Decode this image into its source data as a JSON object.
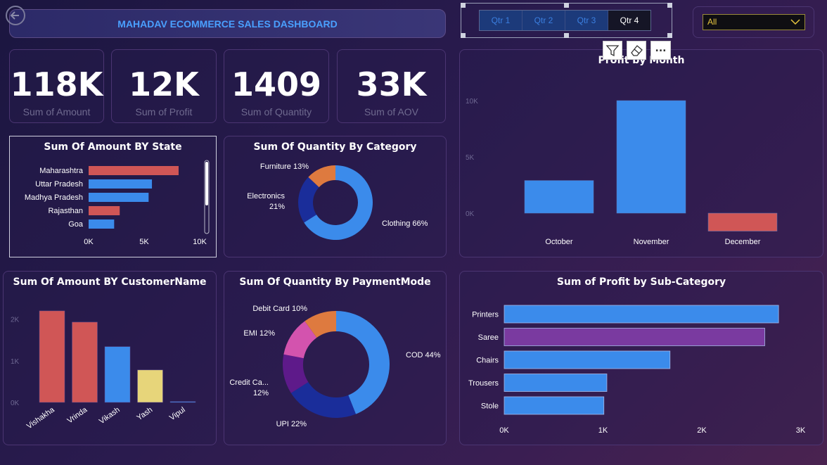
{
  "header": {
    "title": "MAHADAV ECOMMERCE SALES DASHBOARD"
  },
  "slicer": {
    "quarters": [
      "Qtr 1",
      "Qtr 2",
      "Qtr 3",
      "Qtr 4"
    ],
    "selected": "Qtr 4"
  },
  "dropdown": {
    "value": "All"
  },
  "toolbar": {
    "more_label": "..."
  },
  "kpis": [
    {
      "value": "118K",
      "label": "Sum of Amount"
    },
    {
      "value": "12K",
      "label": "Sum of Profit"
    },
    {
      "value": "1409",
      "label": "Sum of Quantity"
    },
    {
      "value": "33K",
      "label": "Sum of AOV"
    }
  ],
  "colors": {
    "blue": "#3b8beb",
    "red": "#d05656",
    "purple": "#7a3aa0",
    "yellow": "#e7d57a",
    "orange": "#de7a3f",
    "navy": "#1a2d9a",
    "magenta": "#d353ae",
    "violet": "#5e1a8a"
  },
  "chart_data": [
    {
      "type": "bar",
      "orientation": "horizontal",
      "title": "Sum Of Amount BY State",
      "categories": [
        "Maharashtra",
        "Uttar Pradesh",
        "Madhya Pradesh",
        "Rajasthan",
        "Goa"
      ],
      "values": [
        8100,
        5700,
        5400,
        2800,
        2300
      ],
      "colors": [
        "#d05656",
        "#3b8beb",
        "#3b8beb",
        "#d05656",
        "#3b8beb"
      ],
      "xticks": [
        "0K",
        "5K",
        "10K"
      ],
      "xlim": [
        0,
        10000
      ]
    },
    {
      "type": "pie",
      "title": "Sum Of Quantity By Category",
      "slices": [
        {
          "label": "Clothing 66%",
          "value": 66,
          "color": "#3b8beb"
        },
        {
          "label": "Electronics 21%",
          "value": 21,
          "color": "#1a2d9a"
        },
        {
          "label": "Furniture 13%",
          "value": 13,
          "color": "#de7a3f"
        }
      ]
    },
    {
      "type": "bar",
      "title": "Profit by Month",
      "categories": [
        "October",
        "November",
        "December"
      ],
      "values": [
        2900,
        10000,
        -1600
      ],
      "colors": [
        "#3b8beb",
        "#3b8beb",
        "#d05656"
      ],
      "yticks": [
        "10K",
        "5K",
        "0K"
      ],
      "ylim": [
        -2000,
        10500
      ]
    },
    {
      "type": "bar",
      "title": "Sum Of Amount BY CustomerName",
      "categories": [
        "Vishakha",
        "Vrinda",
        "Vikash",
        "Yash",
        "Vipul"
      ],
      "values": [
        2200,
        1930,
        1340,
        780,
        20
      ],
      "colors": [
        "#d05656",
        "#d05656",
        "#3b8beb",
        "#e7d57a",
        "#3b8beb"
      ],
      "yticks": [
        "2K",
        "1K",
        "0K"
      ],
      "ylim": [
        0,
        2300
      ]
    },
    {
      "type": "pie",
      "title": "Sum Of Quantity By PaymentMode",
      "slices": [
        {
          "label": "COD 44%",
          "value": 44,
          "color": "#3b8beb"
        },
        {
          "label": "UPI 22%",
          "value": 22,
          "color": "#1a2d9a"
        },
        {
          "label": "Credit Ca... 12%",
          "value": 12,
          "color": "#5e1a8a"
        },
        {
          "label": "EMI 12%",
          "value": 12,
          "color": "#d353ae"
        },
        {
          "label": "Debit Card 10%",
          "value": 10,
          "color": "#de7a3f"
        }
      ]
    },
    {
      "type": "bar",
      "orientation": "horizontal",
      "title": "Sum of Profit by Sub-Category",
      "categories": [
        "Printers",
        "Saree",
        "Chairs",
        "Trousers",
        "Stole"
      ],
      "values": [
        2780,
        2640,
        1680,
        1040,
        1010
      ],
      "colors": [
        "#3b8beb",
        "#7a3aa0",
        "#3b8beb",
        "#3b8beb",
        "#3b8beb"
      ],
      "xticks": [
        "0K",
        "1K",
        "2K",
        "3K"
      ],
      "xlim": [
        0,
        3000
      ]
    }
  ]
}
